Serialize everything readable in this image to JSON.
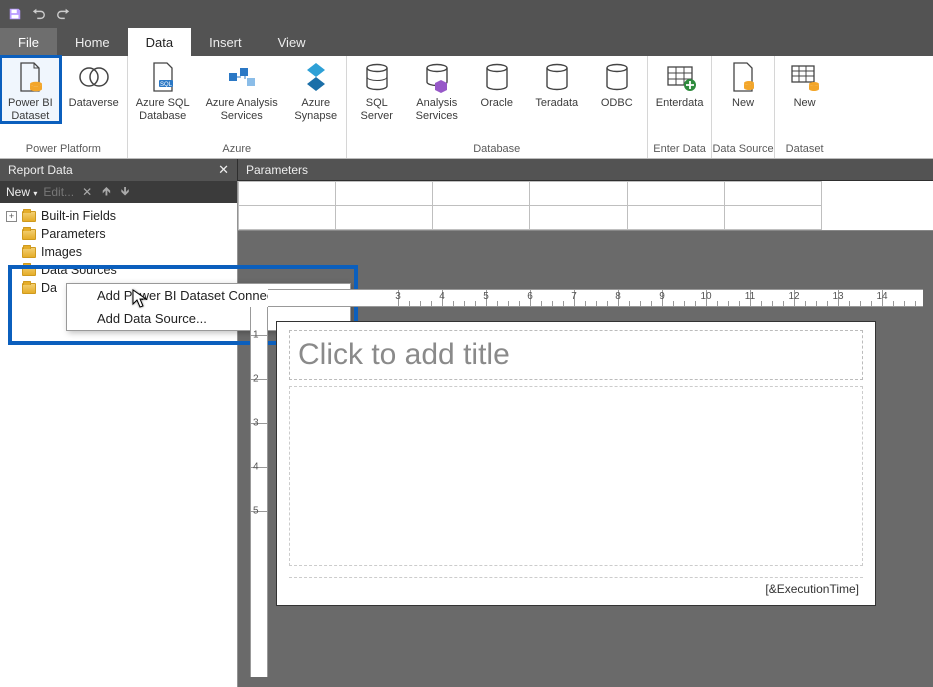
{
  "quick_access": {
    "icons": [
      "save-icon",
      "undo-icon",
      "redo-icon"
    ]
  },
  "tabs": {
    "file": "File",
    "items": [
      {
        "label": "Home",
        "active": false
      },
      {
        "label": "Data",
        "active": true
      },
      {
        "label": "Insert",
        "active": false
      },
      {
        "label": "View",
        "active": false
      }
    ]
  },
  "ribbon": {
    "groups": [
      {
        "label": "Power Platform",
        "items": [
          {
            "line1": "Power BI",
            "line2": "Dataset",
            "icon": "file-bi",
            "highlight": true
          },
          {
            "line1": "Dataverse",
            "line2": "",
            "icon": "dataverse"
          }
        ]
      },
      {
        "label": "Azure",
        "items": [
          {
            "line1": "Azure SQL",
            "line2": "Database",
            "icon": "file-sql"
          },
          {
            "line1": "Azure Analysis",
            "line2": "Services",
            "icon": "azure-cube"
          },
          {
            "line1": "Azure",
            "line2": "Synapse",
            "icon": "azure-synapse"
          }
        ]
      },
      {
        "label": "Database",
        "items": [
          {
            "line1": "SQL",
            "line2": "Server",
            "icon": "db"
          },
          {
            "line1": "Analysis",
            "line2": "Services",
            "icon": "db-cube"
          },
          {
            "line1": "Oracle",
            "line2": "",
            "icon": "db"
          },
          {
            "line1": "Teradata",
            "line2": "",
            "icon": "db"
          },
          {
            "line1": "ODBC",
            "line2": "",
            "icon": "db"
          }
        ]
      },
      {
        "label": "Enter Data",
        "items": [
          {
            "line1": "Enterdata",
            "line2": "",
            "icon": "table-plus"
          }
        ]
      },
      {
        "label": "Data Source",
        "items": [
          {
            "line1": "New",
            "line2": "",
            "icon": "file-db"
          }
        ]
      },
      {
        "label": "Dataset",
        "items": [
          {
            "line1": "New",
            "line2": "",
            "icon": "table-db"
          }
        ]
      }
    ]
  },
  "panels": {
    "left_title": "Report Data",
    "right_title": "Parameters"
  },
  "reportdata": {
    "toolbar": {
      "new": "New",
      "edit": "Edit..."
    },
    "tree": [
      {
        "label": "Built-in Fields",
        "expandable": true
      },
      {
        "label": "Parameters",
        "expandable": false
      },
      {
        "label": "Images",
        "expandable": false
      },
      {
        "label": "Data Sources",
        "expandable": false
      },
      {
        "label": "Datasets",
        "expandable": false,
        "truncated": "Da"
      }
    ],
    "context_menu": [
      "Add Power BI Dataset Connection...",
      "Add Data Source..."
    ]
  },
  "ruler_numbers": [
    3,
    4,
    5,
    6,
    7,
    8,
    9,
    10,
    11,
    12,
    13,
    14
  ],
  "vruler_numbers": [
    1,
    2,
    3,
    4,
    5
  ],
  "canvas": {
    "title_placeholder": "Click to add title",
    "footer_field": "[&ExecutionTime]"
  }
}
